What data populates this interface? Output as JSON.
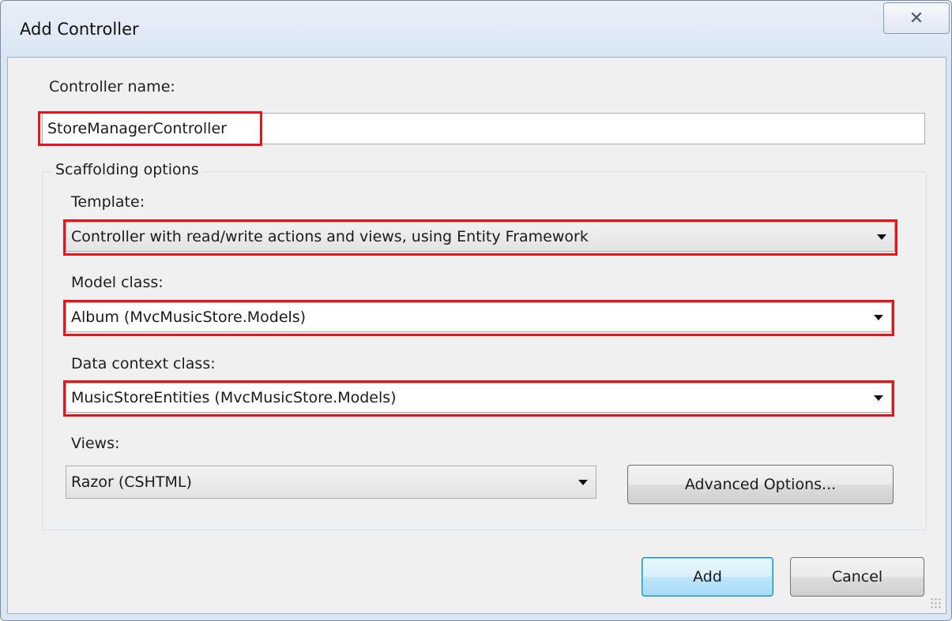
{
  "window": {
    "title": "Add Controller",
    "close_glyph": "✕"
  },
  "controller_name": {
    "label": "Controller name:",
    "value": "StoreManagerController"
  },
  "scaffolding": {
    "legend": "Scaffolding options",
    "template": {
      "label": "Template:",
      "selected": "Controller with read/write actions and views, using Entity Framework"
    },
    "model_class": {
      "label": "Model class:",
      "selected": "Album (MvcMusicStore.Models)"
    },
    "data_context_class": {
      "label": "Data context class:",
      "selected": "MusicStoreEntities (MvcMusicStore.Models)"
    },
    "views": {
      "label": "Views:",
      "selected": "Razor (CSHTML)"
    },
    "advanced_button": "Advanced Options..."
  },
  "buttons": {
    "add": "Add",
    "cancel": "Cancel"
  },
  "colors": {
    "highlight": "#e3151a",
    "default_button_border": "#3c7fb1"
  }
}
